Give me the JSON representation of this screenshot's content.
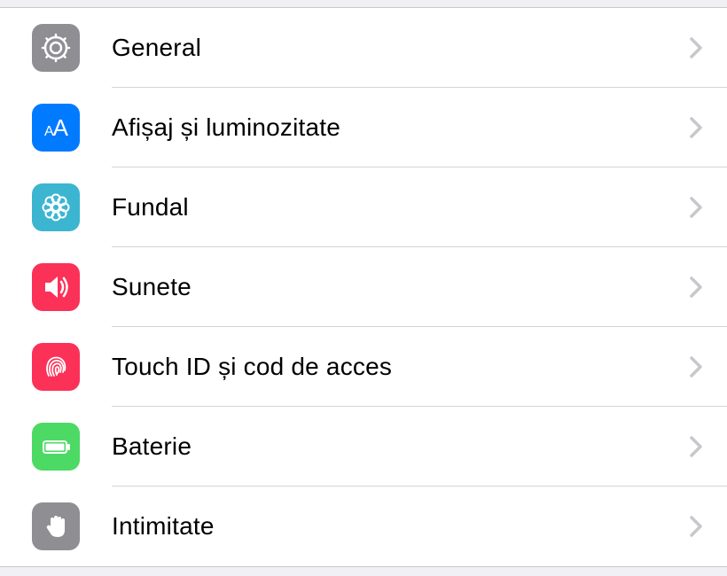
{
  "settings": {
    "items": [
      {
        "key": "general",
        "label": "General",
        "icon": "gear-icon",
        "icon_class": "icon-general"
      },
      {
        "key": "display",
        "label": "Afișaj și luminozitate",
        "icon": "text-size-icon",
        "icon_class": "icon-display"
      },
      {
        "key": "wallpaper",
        "label": "Fundal",
        "icon": "flower-icon",
        "icon_class": "icon-wallpaper"
      },
      {
        "key": "sounds",
        "label": "Sunete",
        "icon": "speaker-icon",
        "icon_class": "icon-sounds"
      },
      {
        "key": "touchid",
        "label": "Touch ID și cod de acces",
        "icon": "fingerprint-icon",
        "icon_class": "icon-touchid"
      },
      {
        "key": "battery",
        "label": "Baterie",
        "icon": "battery-icon",
        "icon_class": "icon-battery"
      },
      {
        "key": "privacy",
        "label": "Intimitate",
        "icon": "hand-icon",
        "icon_class": "icon-privacy"
      }
    ]
  }
}
